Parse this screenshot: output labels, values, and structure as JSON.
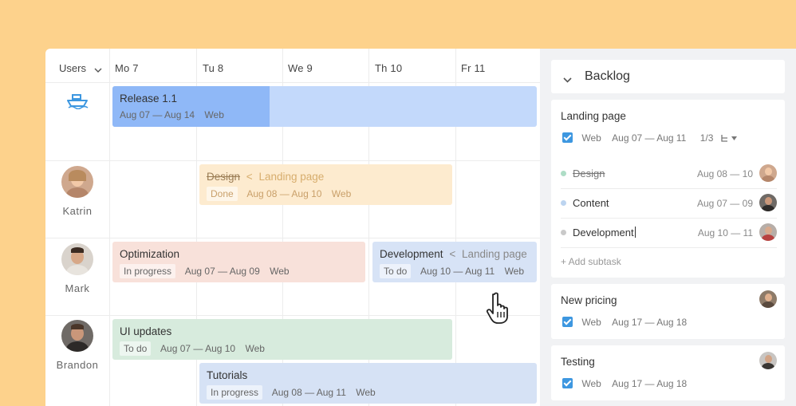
{
  "timeline": {
    "users_label": "Users",
    "days": [
      "Mo 7",
      "Tu 8",
      "We 9",
      "Th 10",
      "Fr 11"
    ]
  },
  "users": [
    {
      "name": "Katrin"
    },
    {
      "name": "Mark"
    },
    {
      "name": "Brandon"
    }
  ],
  "bars": {
    "release": {
      "title": "Release 1.1",
      "dates": "Aug 07 — Aug 14",
      "tag": "Web",
      "progress_fraction": 0.37
    },
    "design": {
      "title": "Design",
      "parent_sep": "<",
      "parent": "Landing page",
      "status": "Done",
      "dates": "Aug 08 — Aug 10",
      "tag": "Web"
    },
    "optimization": {
      "title": "Optimization",
      "status": "In progress",
      "dates": "Aug 07 — Aug 09",
      "tag": "Web"
    },
    "development": {
      "title": "Development",
      "parent_sep": "<",
      "parent": "Landing page",
      "status": "To do",
      "dates": "Aug 10 — Aug 11",
      "tag": "Web"
    },
    "ui_updates": {
      "title": "UI updates",
      "status": "To do",
      "dates": "Aug 07 — Aug 10",
      "tag": "Web"
    },
    "tutorials": {
      "title": "Tutorials",
      "status": "In progress",
      "dates": "Aug 08 — Aug 11",
      "tag": "Web"
    }
  },
  "backlog": {
    "title": "Backlog",
    "landing": {
      "title": "Landing page",
      "tag": "Web",
      "dates": "Aug 07 — Aug 11",
      "subtasks_count": "1/3",
      "subtasks": [
        {
          "name": "Design",
          "dates": "Aug 08 — 10",
          "done": true
        },
        {
          "name": "Content",
          "dates": "Aug 07 — 09",
          "done": false
        },
        {
          "name": "Development",
          "dates": "Aug 10 — 11",
          "done": false
        }
      ],
      "add_subtask": "+ Add subtask"
    },
    "pricing": {
      "title": "New pricing",
      "tag": "Web",
      "dates": "Aug 17 — Aug 18"
    },
    "testing": {
      "title": "Testing",
      "tag": "Web",
      "dates": "Aug 17 — Aug 18"
    }
  },
  "colors": {
    "background": "#fdd28c",
    "release_done": "#8fb8f7",
    "release_rest": "#c3d9fb",
    "design": "#fdebcf",
    "optimization": "#f8e1da",
    "development": "#d7e3f6",
    "ui_updates": "#d7ebdd",
    "tutorials": "#d6e2f5",
    "accent": "#3d97e0"
  }
}
